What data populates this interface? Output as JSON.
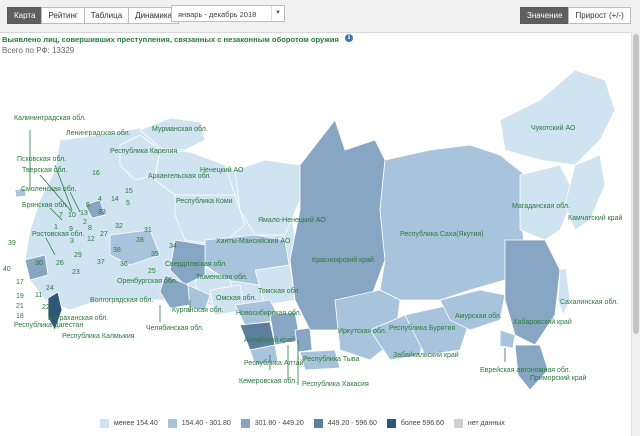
{
  "toolbar": {
    "tabs": [
      {
        "label": "Карта",
        "active": true
      },
      {
        "label": "Рейтинг",
        "active": false
      },
      {
        "label": "Таблица",
        "active": false
      },
      {
        "label": "Динамика",
        "active": false
      }
    ],
    "period": "январь - декабрь 2018",
    "mode_tabs": [
      {
        "label": "Значение",
        "active": true
      },
      {
        "label": "Прирост (+/-)",
        "active": false
      }
    ]
  },
  "title": "Выявлено лиц, совершивших преступления, связанных с незаконным оборотом оружия",
  "total": "Всего по РФ: 13329",
  "colors": {
    "bin1": "#cfe3f1",
    "bin2": "#a8c4dc",
    "bin3": "#86a6c3",
    "bin4": "#5c7f9e",
    "bin5": "#2f5677",
    "no_data": "#cfcfcf",
    "label": "#2a7a3b"
  },
  "legend": [
    {
      "label": "менее 154.40",
      "color": "#cfe3f1"
    },
    {
      "label": "154.40 - 301.80",
      "color": "#a8c4dc"
    },
    {
      "label": "301.80 - 449.20",
      "color": "#86a6c3"
    },
    {
      "label": "449.20 - 596.60",
      "color": "#5c7f9e"
    },
    {
      "label": "более 596.60",
      "color": "#2f5677"
    },
    {
      "label": "нет данных",
      "color": "#cfcfcf"
    }
  ],
  "regions": {
    "kaliningrad": "Калининградская обл.",
    "leningrad": "Ленинградская обл.",
    "murmansk": "Мурманская обл.",
    "karelia": "Республика Карелия",
    "pskov": "Псковская обл.",
    "tver": "Тверская обл.",
    "smolensk": "Смоленская обл.",
    "bryansk": "Брянская обл.",
    "rostov": "Ростовская обл.",
    "arkhangelsk": "Архангельская обл.",
    "nenets": "Ненецкий АО",
    "komi": "Республика Коми",
    "yamal": "Ямало-Ненецкий АО",
    "khanty": "Ханты-Мансийский АО",
    "sverdlovsk": "Свердловская обл.",
    "tyumen": "Тюменская обл.",
    "orenburg": "Оренбургская обл.",
    "volgograd": "Волгоградская обл.",
    "astrakhan": "Астраханская обл.",
    "kalmykia": "Республика Калмыкия",
    "dagestan": "Республика Дагестан",
    "kurgan": "Курганская обл.",
    "chelyabinsk": "Челябинская обл.",
    "omsk": "Омская обл.",
    "tomsk": "Томская обл.",
    "novosibirsk": "Новосибирская обл.",
    "altai_krai": "Алтайский край",
    "altai_rep": "Республика Алтай",
    "kemerovo": "Кемеровская обл.",
    "tyva": "Республика Тыва",
    "khakassia": "Республика Хакасия",
    "krasnoyarsk": "Красноярский край",
    "irkutsk": "Иркутская обл.",
    "buryatia": "Республика Бурятия",
    "zabaikalsky": "Забайкальский край",
    "amur": "Амурская обл.",
    "yakutia": "Республика Саха(Якутия)",
    "magadan": "Магаданская обл.",
    "chukotka": "Чукотский АО",
    "kamchatka": "Камчатский край",
    "khabarovsk": "Хабаровский край",
    "jewish": "Еврейская автономная обл.",
    "primorsky": "Приморский край",
    "sakhalin": "Сахалинская обл."
  },
  "numbers": [
    "16",
    "15",
    "4",
    "14",
    "5",
    "6",
    "7",
    "10",
    "13",
    "33",
    "2",
    "3",
    "9",
    "8",
    "12",
    "27",
    "31",
    "32",
    "34",
    "1",
    "39",
    "28",
    "38",
    "36",
    "37",
    "25",
    "35",
    "29",
    "26",
    "23",
    "30",
    "24",
    "40",
    "17",
    "19",
    "21",
    "22",
    "18",
    "11"
  ]
}
